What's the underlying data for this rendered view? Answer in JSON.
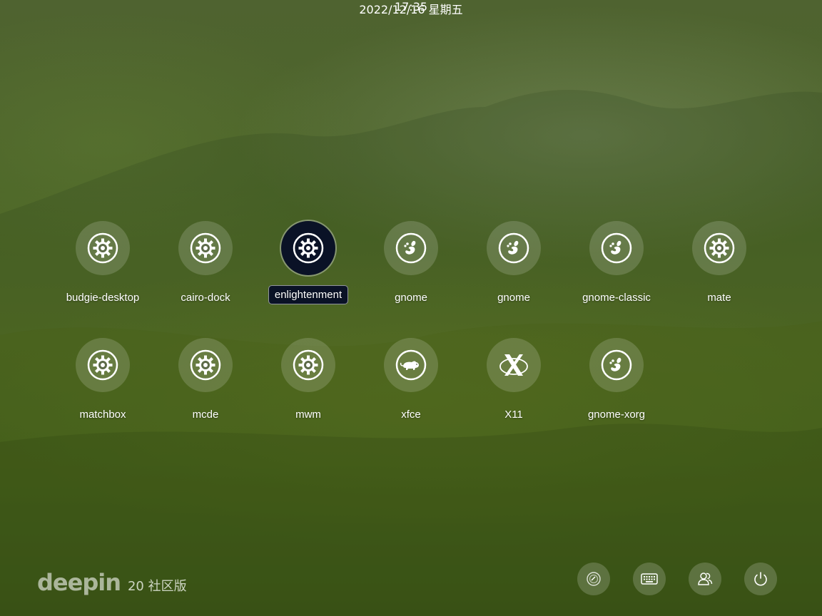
{
  "clock": {
    "time": "17:35",
    "date": "2022/12/16 星期五"
  },
  "sessions": [
    {
      "label": "budgie-desktop",
      "icon": "gear-icon"
    },
    {
      "label": "cairo-dock",
      "icon": "gear-icon"
    },
    {
      "label": "enlightenment",
      "icon": "gear-icon",
      "selected": true
    },
    {
      "label": "gnome",
      "icon": "gnome-foot-icon"
    },
    {
      "label": "gnome",
      "icon": "gnome-foot-icon"
    },
    {
      "label": "gnome-classic",
      "icon": "gnome-foot-icon"
    },
    {
      "label": "mate",
      "icon": "gear-icon"
    },
    {
      "label": "matchbox",
      "icon": "gear-icon"
    },
    {
      "label": "mcde",
      "icon": "gear-icon"
    },
    {
      "label": "mwm",
      "icon": "gear-icon"
    },
    {
      "label": "xfce",
      "icon": "xfce-mouse-icon"
    },
    {
      "label": "X11",
      "icon": "x11-icon"
    },
    {
      "label": "gnome-xorg",
      "icon": "gnome-foot-icon"
    }
  ],
  "branding": {
    "logo": "deepin",
    "version": "20 社区版"
  },
  "bottom_buttons": [
    {
      "name": "session-switch-button",
      "icon": "session-icon"
    },
    {
      "name": "keyboard-layout-button",
      "icon": "keyboard-icon"
    },
    {
      "name": "switch-user-button",
      "icon": "users-icon"
    },
    {
      "name": "power-button",
      "icon": "power-icon"
    }
  ],
  "colors": {
    "selected_bg": "#0a1226",
    "accent_white": "#ffffff"
  }
}
